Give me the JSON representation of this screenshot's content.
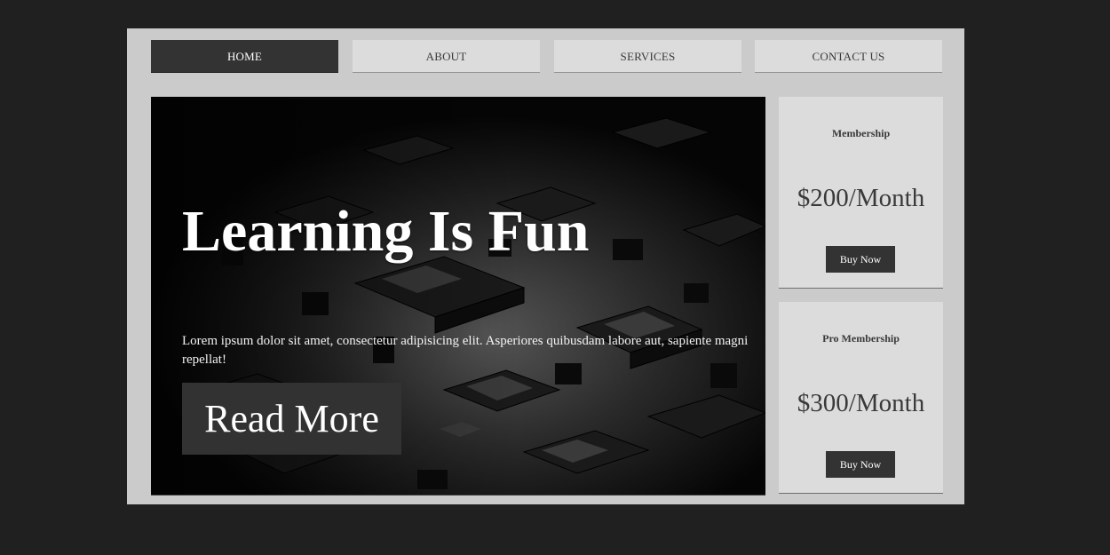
{
  "nav": {
    "items": [
      {
        "label": "HOME",
        "active": true
      },
      {
        "label": "ABOUT",
        "active": false
      },
      {
        "label": "SERVICES",
        "active": false
      },
      {
        "label": "CONTACT US",
        "active": false
      }
    ]
  },
  "hero": {
    "title": "Learning Is Fun",
    "text": "Lorem ipsum dolor sit amet, consectetur adipisicing elit. Asperiores quibusdam labore aut, sapiente magni repellat!",
    "button_label": "Read More"
  },
  "plans": [
    {
      "name": "Membership",
      "price": "$200/Month",
      "button_label": "Buy Now"
    },
    {
      "name": "Pro Membership",
      "price": "$300/Month",
      "button_label": "Buy Now"
    }
  ],
  "colors": {
    "page_background": "#202020",
    "panel_background": "#cbcbcb",
    "nav_active": "#333333",
    "nav_inactive": "#dcdcdc",
    "button_dark": "#333333"
  }
}
